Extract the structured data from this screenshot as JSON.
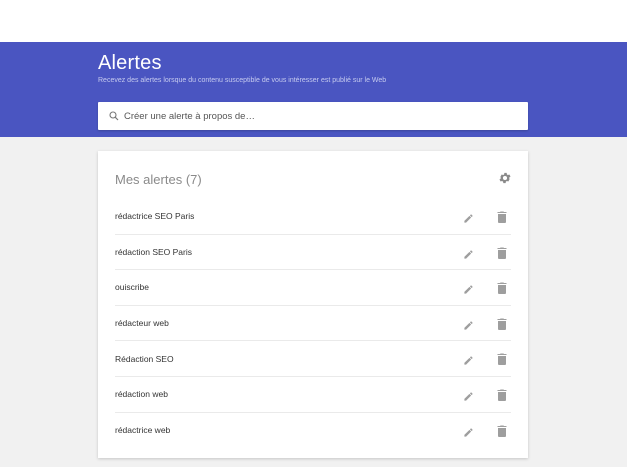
{
  "header": {
    "title": "Alertes",
    "subtitle": "Recevez des alertes lorsque du contenu susceptible de vous intéresser est publié sur le Web",
    "color": "#4a55c1"
  },
  "search": {
    "placeholder": "Créer une alerte à propos de…",
    "icon": "search-icon"
  },
  "alerts": {
    "heading": "Mes alertes",
    "count": "(7)",
    "settings_icon": "gear-icon",
    "items": [
      {
        "label": "rédactrice SEO Paris"
      },
      {
        "label": "rédaction SEO Paris"
      },
      {
        "label": "ouiscribe"
      },
      {
        "label": "rédacteur web"
      },
      {
        "label": "Rédaction SEO"
      },
      {
        "label": "rédaction web"
      },
      {
        "label": "rédactrice web"
      }
    ],
    "edit_icon": "pencil-icon",
    "delete_icon": "trash-icon"
  }
}
